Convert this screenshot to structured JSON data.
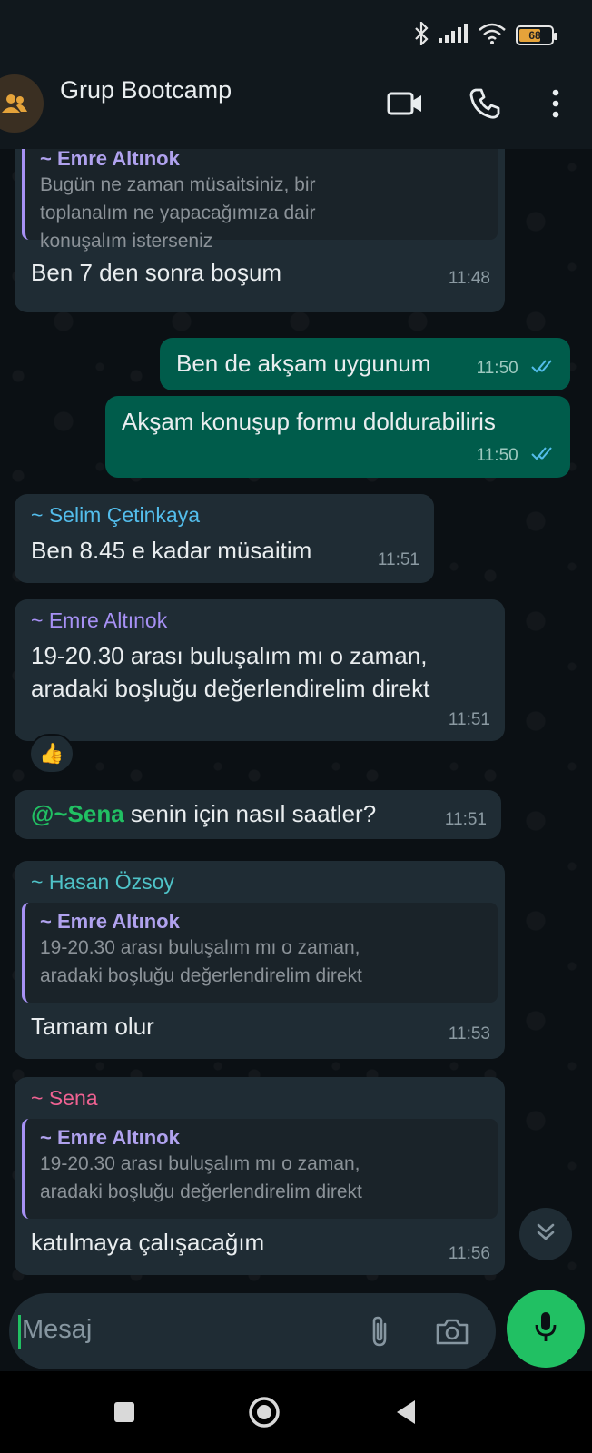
{
  "status_bar": {
    "battery_level": "68",
    "icons": [
      "bluetooth-icon",
      "signal-icon",
      "wifi-icon",
      "battery-icon"
    ]
  },
  "header": {
    "title": "Grup Bootcamp",
    "icons": [
      "group-avatar-icon",
      "video-call-icon",
      "voice-call-icon",
      "more-options-icon"
    ]
  },
  "messages": [
    {
      "direction": "in",
      "quote": {
        "author": "~ Emre Altınok",
        "text": [
          "Bugün ne zaman müsaitsiniz, bir",
          "toplanalım ne yapacağımıza dair",
          "konuşalım isterseniz"
        ]
      },
      "text": "Ben 7 den sonra boşum",
      "time": "11:48"
    },
    {
      "direction": "out",
      "text": "Ben de akşam uygunum",
      "time": "11:50",
      "read": true
    },
    {
      "direction": "out",
      "text": "Akşam konuşup formu doldurabiliris",
      "time": "11:50",
      "read": true
    },
    {
      "direction": "in",
      "sender": "~ Selim Çetinkaya",
      "sender_color": "#53bdeb",
      "text": "Ben 8.45 e kadar müsaitim",
      "time": "11:51"
    },
    {
      "direction": "in",
      "sender": "~ Emre Altınok",
      "sender_color": "#a791f5",
      "text": [
        "19-20.30 arası buluşalım mı o zaman,",
        "aradaki boşluğu değerlendirelim direkt"
      ],
      "time": "11:51",
      "reaction": "👍"
    },
    {
      "direction": "in",
      "mention": "@~Sena",
      "mention_color": "#21c063",
      "text": " senin için nasıl saatler?",
      "time": "11:51"
    },
    {
      "direction": "in",
      "sender": "~ Hasan Özsoy",
      "sender_color": "#4fc3c8",
      "quote": {
        "author": "~ Emre Altınok",
        "text": [
          "19-20.30 arası buluşalım mı o zaman,",
          "aradaki boşluğu değerlendirelim direkt"
        ]
      },
      "text": "Tamam olur",
      "time": "11:53"
    },
    {
      "direction": "in",
      "sender": "~ Sena",
      "sender_color": "#f06292",
      "quote": {
        "author": "~ Emre Altınok",
        "text": [
          "19-20.30 arası buluşalım mı o zaman,",
          "aradaki boşluğu değerlendirelim direkt"
        ]
      },
      "text": "katılmaya çalışacağım",
      "time": "11:56"
    }
  ],
  "input": {
    "placeholder": "Mesaj",
    "icons": [
      "attach-icon",
      "camera-icon",
      "microphone-icon"
    ]
  },
  "nav": {
    "icons": [
      "recents-square-icon",
      "home-circle-icon",
      "back-triangle-icon"
    ]
  },
  "colors": {
    "accent": "#21c063",
    "outgoing_bubble": "#005c4b",
    "incoming_bubble": "#1f2c34",
    "background": "#0b1014"
  }
}
